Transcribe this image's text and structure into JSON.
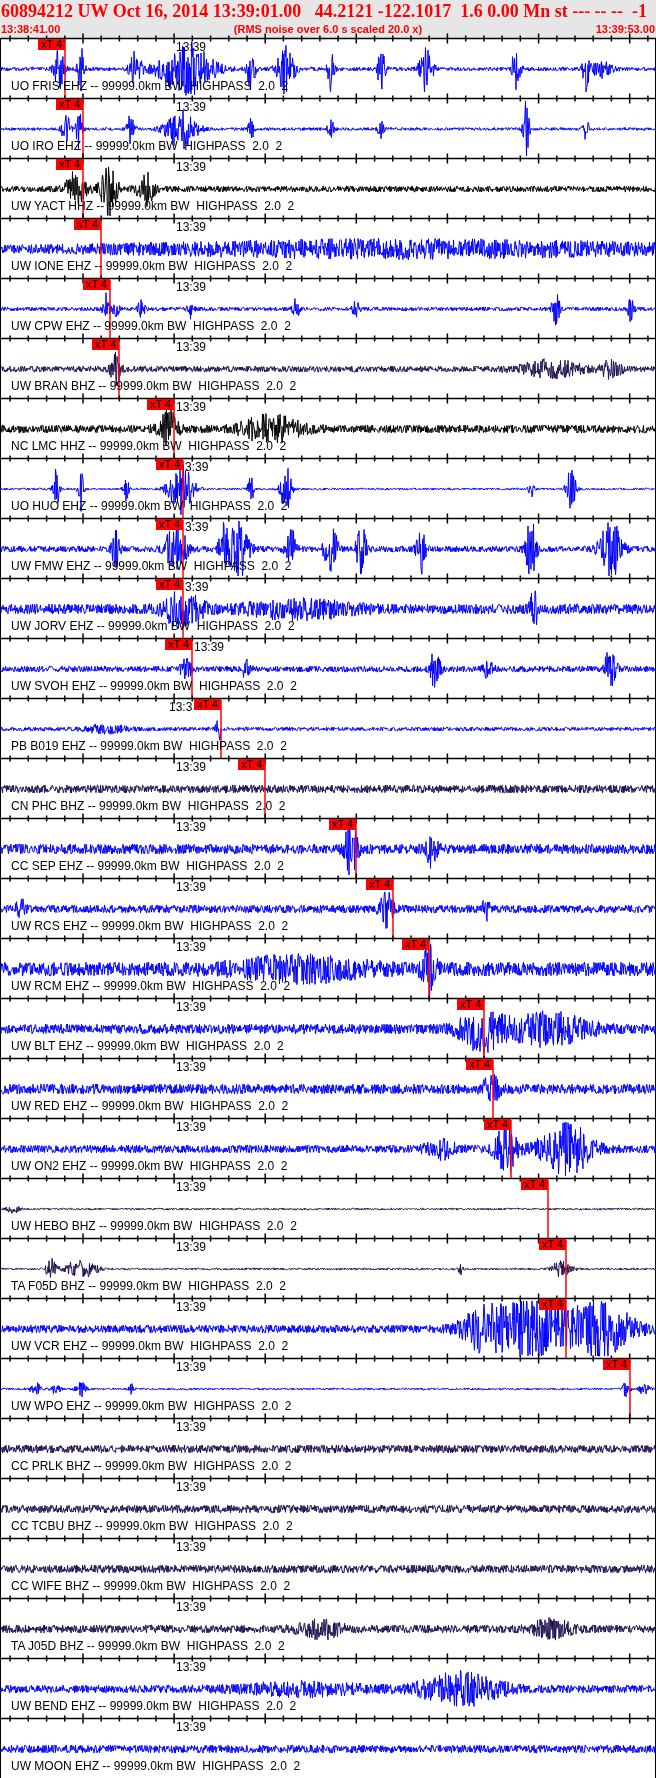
{
  "header": {
    "title": "60894212 UW Oct 16, 2014 13:39:01.00   44.2121 -122.1017  1.6 0.00 Mn st --- -- --  -1",
    "start_time": "13:38:41.00",
    "note": "(RMS noise over 6.0 s scaled 20.0 x)",
    "end_time": "13:39:53.00"
  },
  "traces": [
    {
      "label": "UO FRIS EHZ -- 99999.0km BW  HIGHPASS  2.0  2",
      "time_label": "13:39",
      "color": "#0000ff",
      "pick": "xT 4"
    },
    {
      "label": "UO IRO EHZ -- 99999.0km BW  HIGHPASS  2.0  2",
      "time_label": "13:39",
      "color": "#0000ff",
      "pick": "xT 4"
    },
    {
      "label": "UW YACT HHZ -- 99999.0km BW  HIGHPASS  2.0  2",
      "time_label": "13:39",
      "color": "#000000",
      "pick": "xT 4"
    },
    {
      "label": "UW IONE EHZ -- 99999.0km BW  HIGHPASS  2.0  2",
      "time_label": "13:39",
      "color": "#0000ff",
      "pick": "xT 4"
    },
    {
      "label": "UW CPW EHZ -- 99999.0km BW  HIGHPASS  2.0  2",
      "time_label": "13:39",
      "color": "#0000ff",
      "pick": "xT 4"
    },
    {
      "label": "UW BRAN BHZ -- 99999.0km BW  HIGHPASS  2.0  2",
      "time_label": "13:39",
      "color": "#1f0f4f",
      "pick": "xT 4"
    },
    {
      "label": "NC LMC HHZ -- 99999.0km BW  HIGHPASS  2.0  2",
      "time_label": "13:39",
      "color": "#000000",
      "pick": "xT 4"
    },
    {
      "label": "UO HUO EHZ -- 99999.0km BW  HIGHPASS  2.0  2",
      "time_label": "3:39",
      "color": "#0000ff",
      "pick": "xT 4"
    },
    {
      "label": "UW FMW EHZ -- 99999.0km BW  HIGHPASS  2.0  2",
      "time_label": "3:39",
      "color": "#0000ff",
      "pick": "xT 4"
    },
    {
      "label": "UW JORV EHZ -- 99999.0km BW  HIGHPASS  2.0  2",
      "time_label": "3:39",
      "color": "#0000ff",
      "pick": "xT 4"
    },
    {
      "label": "UW SVOH EHZ -- 99999.0km BW  HIGHPASS  2.0  2",
      "time_label": "13:39",
      "color": "#0000ff",
      "pick": "xT 4"
    },
    {
      "label": "PB B019 EHZ -- 99999.0km BW  HIGHPASS  2.0  2",
      "time_label": "13:3",
      "color": "#0000ff",
      "pick": "xT 4"
    },
    {
      "label": "CN PHC BHZ -- 99999.0km BW  HIGHPASS  2.0  2",
      "time_label": "13:39",
      "color": "#1f0f4f",
      "pick": "xT 4"
    },
    {
      "label": "CC SEP EHZ -- 99999.0km BW  HIGHPASS  2.0  2",
      "time_label": "13:39",
      "color": "#0000ff",
      "pick": "xT 4"
    },
    {
      "label": "UW RCS EHZ -- 99999.0km BW  HIGHPASS  2.0  2",
      "time_label": "13:39",
      "color": "#0000ff",
      "pick": "xT 4"
    },
    {
      "label": "UW RCM EHZ -- 99999.0km BW  HIGHPASS  2.0  2",
      "time_label": "13:39",
      "color": "#0000ff",
      "pick": "xT 4"
    },
    {
      "label": "UW BLT EHZ -- 99999.0km BW  HIGHPASS  2.0  2",
      "time_label": "13:39",
      "color": "#0000ff",
      "pick": "xT 4"
    },
    {
      "label": "UW RED EHZ -- 99999.0km BW  HIGHPASS  2.0  2",
      "time_label": "13:39",
      "color": "#0000ff",
      "pick": "xT 4"
    },
    {
      "label": "UW ON2 EHZ -- 99999.0km BW  HIGHPASS  2.0  2",
      "time_label": "13:39",
      "color": "#0000ff",
      "pick": "xT 4"
    },
    {
      "label": "UW HEBO BHZ -- 99999.0km BW  HIGHPASS  2.0  2",
      "time_label": "13:39",
      "color": "#1f0f4f",
      "pick": "xT 4"
    },
    {
      "label": "TA F05D BHZ -- 99999.0km BW  HIGHPASS  2.0  2",
      "time_label": "13:39",
      "color": "#1f0f4f",
      "pick": "xT 4"
    },
    {
      "label": "UW VCR EHZ -- 99999.0km BW  HIGHPASS  2.0  2",
      "time_label": "13:39",
      "color": "#0000ff",
      "pick": "xT 4"
    },
    {
      "label": "UW WPO EHZ -- 99999.0km BW  HIGHPASS  2.0  2",
      "time_label": "13:39",
      "color": "#0000ff",
      "pick": "xT 4"
    },
    {
      "label": "CC PRLK BHZ -- 99999.0km BW  HIGHPASS  2.0  2",
      "time_label": "13:39",
      "color": "#1f0f4f"
    },
    {
      "label": "CC TCBU BHZ -- 99999.0km BW  HIGHPASS  2.0  2",
      "time_label": "13:39",
      "color": "#1f0f4f"
    },
    {
      "label": "CC WIFE BHZ -- 99999.0km BW  HIGHPASS  2.0  2",
      "time_label": "13:39",
      "color": "#1f0f4f"
    },
    {
      "label": "TA J05D BHZ -- 99999.0km BW  HIGHPASS  2.0  2",
      "time_label": "13:39",
      "color": "#1f0f4f"
    },
    {
      "label": "UW BEND EHZ -- 99999.0km BW  HIGHPASS  2.0  2",
      "time_label": "13:39",
      "color": "#0000ff"
    },
    {
      "label": "UW MOON EHZ -- 99999.0km BW  HIGHPASS  2.0  2",
      "time_label": "13:39",
      "color": "#0000ff"
    }
  ]
}
